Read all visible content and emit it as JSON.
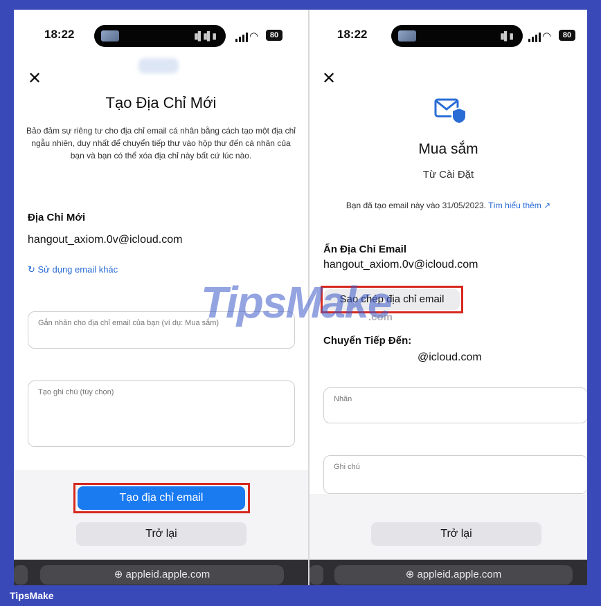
{
  "status": {
    "time": "18:22",
    "battery": "80"
  },
  "left": {
    "title": "Tạo Địa Chỉ Mới",
    "description": "Bảo đảm sự riêng tư cho địa chỉ email cá nhân bằng cách tạo một địa chỉ ngẫu nhiên, duy nhất để chuyển tiếp thư vào hộp thư đến cá nhân của bạn và bạn có thể xóa địa chỉ này bất cứ lúc nào.",
    "new_address_label": "Địa Chỉ Mới",
    "new_address_value": "hangout_axiom.0v@icloud.com",
    "use_other_link": "↻ Sử dụng email khác",
    "label_placeholder": "Gắn nhãn cho địa chỉ email của bạn (ví dụ: Mua sắm)",
    "note_placeholder": "Tạo ghi chú (tùy chọn)",
    "create_button": "Tạo địa chỉ email",
    "back_button": "Trở lại",
    "url": "⊕ appleid.apple.com"
  },
  "right": {
    "title": "Mua sắm",
    "subtitle": "Từ Cài Đặt",
    "created_info": "Bạn đã tạo email này vào 31/05/2023.",
    "learn_more": "Tìm hiểu thêm ↗",
    "hide_email_label": "Ẩn Địa Chỉ Email",
    "hide_email_value": "hangout_axiom.0v@icloud.com",
    "copy_button": "Sao chép địa chỉ email",
    "forward_label": "Chuyển Tiếp Đến:",
    "forward_value": "@icloud.com",
    "label_field": "Nhãn",
    "note_field": "Ghi chú",
    "back_button": "Trở lại",
    "url": "⊕ appleid.apple.com"
  },
  "watermark": {
    "main": "TipsMake",
    "suffix": ".com"
  },
  "footer": "TipsMake"
}
